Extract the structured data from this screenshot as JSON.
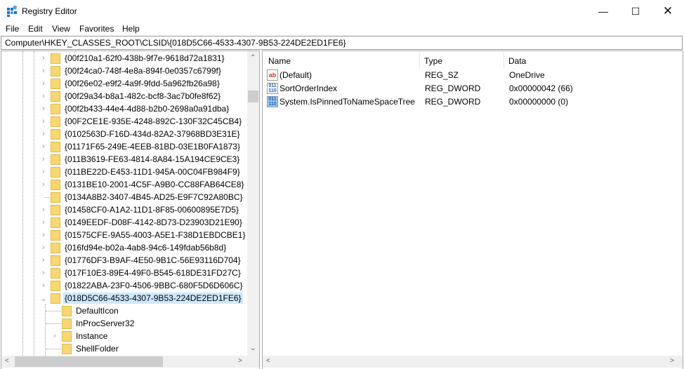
{
  "window": {
    "title": "Registry Editor",
    "controls": [
      "minimize",
      "maximize",
      "close"
    ]
  },
  "menu": [
    "File",
    "Edit",
    "View",
    "Favorites",
    "Help"
  ],
  "address": "Computer\\HKEY_CLASSES_ROOT\\CLSID\\{018D5C66-4533-4307-9B53-224DE2ED1FE6}",
  "tree": {
    "keys": [
      "{00f210a1-62f0-438b-9f7e-9618d72a1831}",
      "{00f24ca0-748f-4e8a-894f-0e0357c6799f}",
      "{00f26e02-e9f2-4a9f-9fdd-5a962fb26a98}",
      "{00f29a34-b8a1-482c-bcf8-3ac7b0fe8f62}",
      "{00f2b433-44e4-4d88-b2b0-2698a0a91dba}",
      "{00F2CE1E-935E-4248-892C-130F32C45CB4}",
      "{0102563D-F16D-434d-82A2-37968BD3E31E}",
      "{01171F65-249E-4EEB-81BD-03E1B0FA1873}",
      "{011B3619-FE63-4814-8A84-15A194CE9CE3}",
      "{011BE22D-E453-11D1-945A-00C04FB984F9}",
      "{0131BE10-2001-4C5F-A9B0-CC88FAB64CE8}",
      "{0134A8B2-3407-4B45-AD25-E9F7C92A80BC}",
      "{01458CF0-A1A2-11D1-8F85-00600895E7D5}",
      "{0149EEDF-D08F-4142-8D73-D23903D21E90}",
      "{01575CFE-9A55-4003-A5E1-F38D1EBDCBE1}",
      "{016fd94e-b02a-4ab8-94c6-149fdab56b8d}",
      "{01776DF3-B9AF-4E50-9B1C-56E93116D704}",
      "{017F10E3-89E4-49F0-B545-618DE31FD27C}",
      "{01822ABA-23F0-4506-9BBC-680F5D6D606C}",
      "{018D5C66-4533-4307-9B53-224DE2ED1FE6}"
    ],
    "expandable": [
      true,
      true,
      true,
      true,
      true,
      true,
      true,
      true,
      true,
      true,
      true,
      false,
      true,
      true,
      true,
      true,
      true,
      true,
      true,
      "expanded"
    ],
    "selected_index": 19,
    "subkeys": [
      {
        "label": "DefaultIcon",
        "expandable": false
      },
      {
        "label": "InProcServer32",
        "expandable": false
      },
      {
        "label": "Instance",
        "expandable": true
      },
      {
        "label": "ShellFolder",
        "expandable": false
      }
    ]
  },
  "values": {
    "columns": [
      "Name",
      "Type",
      "Data"
    ],
    "rows": [
      {
        "icon": "string-value-icon",
        "name": "(Default)",
        "type": "REG_SZ",
        "data": "OneDrive"
      },
      {
        "icon": "binary-value-icon",
        "name": "SortOrderIndex",
        "type": "REG_DWORD",
        "data": "0x00000042 (66)"
      },
      {
        "icon": "binary-value-icon",
        "name": "System.IsPinnedToNameSpaceTree",
        "type": "REG_DWORD",
        "data": "0x00000000 (0)"
      }
    ]
  }
}
